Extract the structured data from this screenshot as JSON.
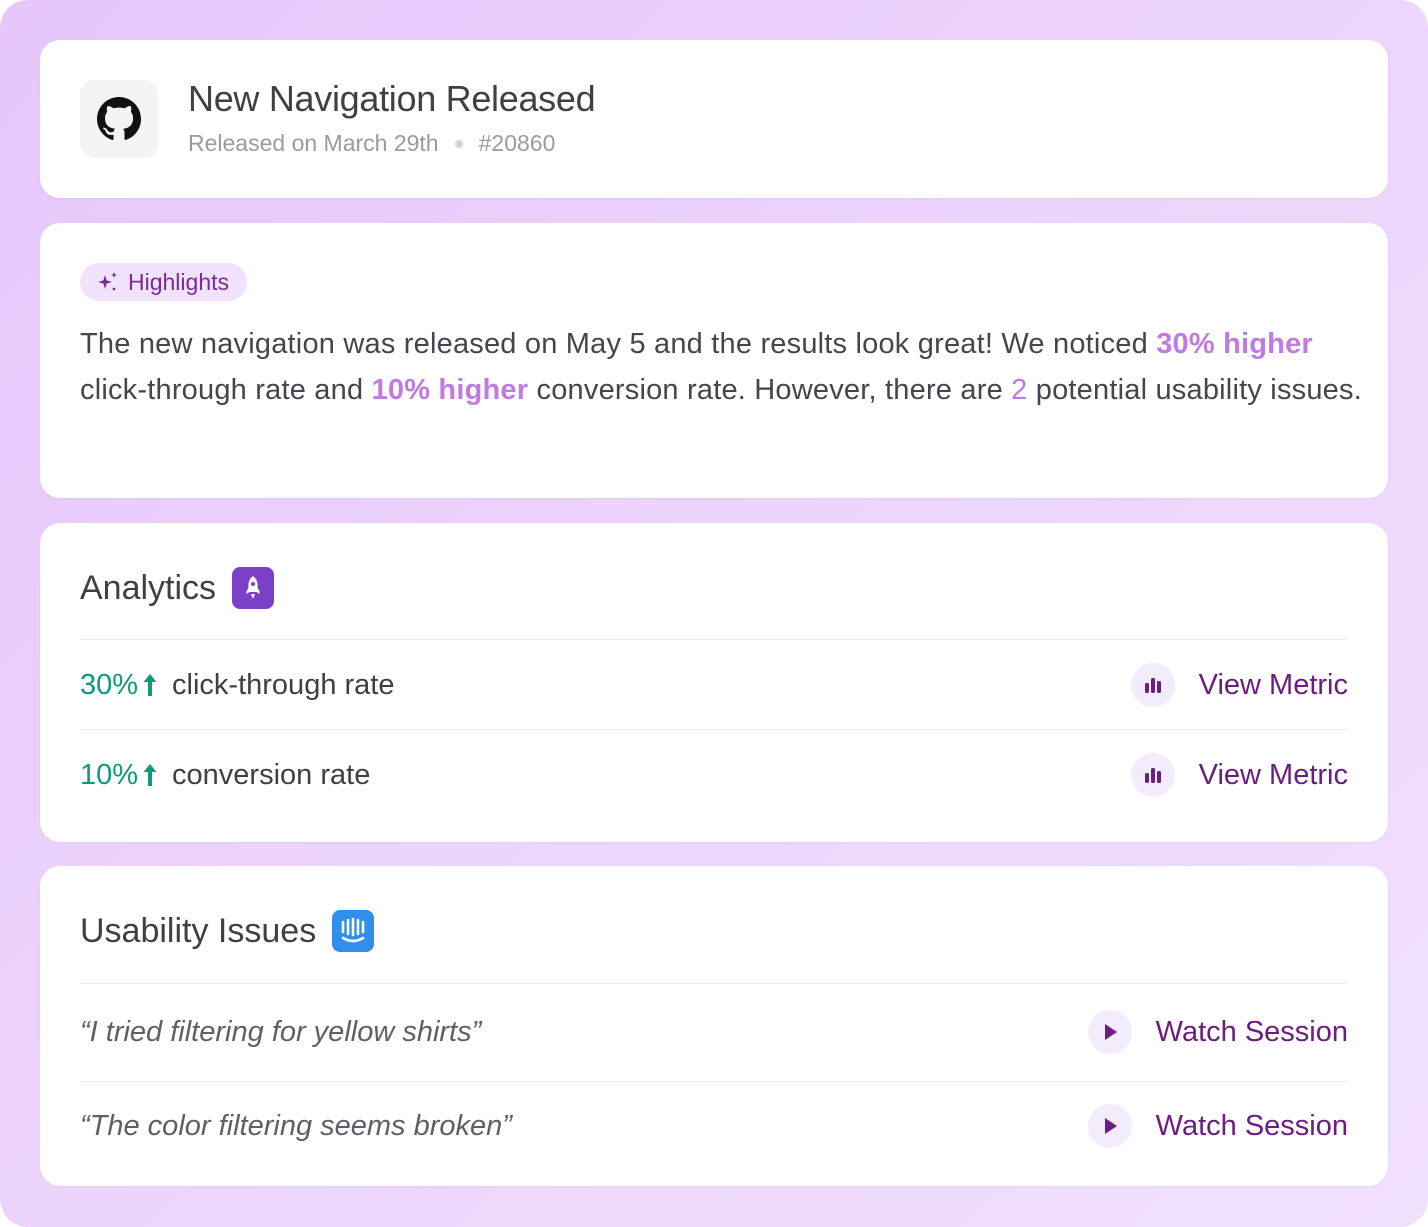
{
  "colors": {
    "accent": "#c07ae5",
    "link": "#6b1d80",
    "positive": "#0e9a7e",
    "analytics_badge": "#7c3fc7",
    "intercom_badge": "#2f8fea"
  },
  "header": {
    "icon": "github-icon",
    "title": "New Navigation Released",
    "released": "Released on March 29th",
    "pr_number": "#20860"
  },
  "highlights": {
    "icon": "sparkles-icon",
    "label": "Highlights",
    "text_1": "The new navigation was released on May 5 and the results look great! We noticed ",
    "strong_1": "30% higher",
    "text_2": " click-through rate and ",
    "strong_2": "10% higher",
    "text_3": " conversion rate. However, there are ",
    "issue_count": "2",
    "text_4": " potential usability issues."
  },
  "analytics": {
    "title": "Analytics",
    "badge_icon": "rocket-icon",
    "rows": [
      {
        "value": "30%",
        "trend": "up-arrow-icon",
        "label": "click-through rate",
        "action_icon": "bar-chart-icon",
        "action": "View Metric"
      },
      {
        "value": "10%",
        "trend": "up-arrow-icon",
        "label": "conversion rate",
        "action_icon": "bar-chart-icon",
        "action": "View Metric"
      }
    ]
  },
  "usability": {
    "title": "Usability Issues",
    "badge_icon": "intercom-icon",
    "rows": [
      {
        "quote": "“I tried filtering for yellow shirts”",
        "action_icon": "play-icon",
        "action": "Watch Session"
      },
      {
        "quote": "“The color filtering seems broken”",
        "action_icon": "play-icon",
        "action": "Watch Session"
      }
    ]
  }
}
